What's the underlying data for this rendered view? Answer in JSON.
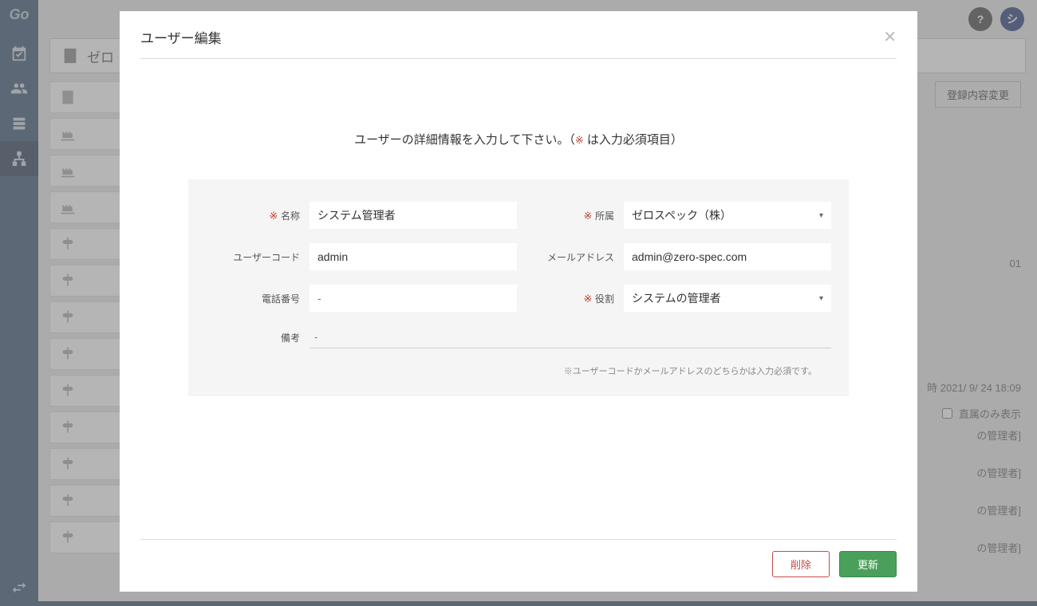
{
  "sidebar": {
    "logo": "Go"
  },
  "topbar": {
    "help": "?",
    "avatar": "シ"
  },
  "header": {
    "title": "ゼロ"
  },
  "right": {
    "change_btn": "登録内容変更",
    "code": "01",
    "timestamp": "時 2021/ 9/ 24 18:09",
    "direct_only": "直属のみ表示",
    "row1": "の管理者]",
    "row2": "の管理者]",
    "row3": "の管理者]",
    "row4": "の管理者]"
  },
  "modal": {
    "title": "ユーザー編集",
    "instruction_pre": "ユーザーの詳細情報を入力して下さい。（",
    "instruction_req": "※",
    "instruction_post": " は入力必須項目）",
    "labels": {
      "name": "※ 名称",
      "affiliation": "※ 所属",
      "user_code": "ユーザーコード",
      "email": "メールアドレス",
      "phone": "電話番号",
      "role": "※ 役割",
      "remark": "備考"
    },
    "values": {
      "name": "システム管理者",
      "affiliation": "ゼロスペック（株）",
      "user_code": "admin",
      "email": "admin@zero-spec.com",
      "phone": "",
      "role": "システムの管理者",
      "remark": ""
    },
    "placeholders": {
      "phone": "-",
      "remark": "-"
    },
    "note": "※ユーザーコードかメールアドレスのどちらかは入力必須です。",
    "buttons": {
      "delete": "削除",
      "update": "更新"
    }
  }
}
